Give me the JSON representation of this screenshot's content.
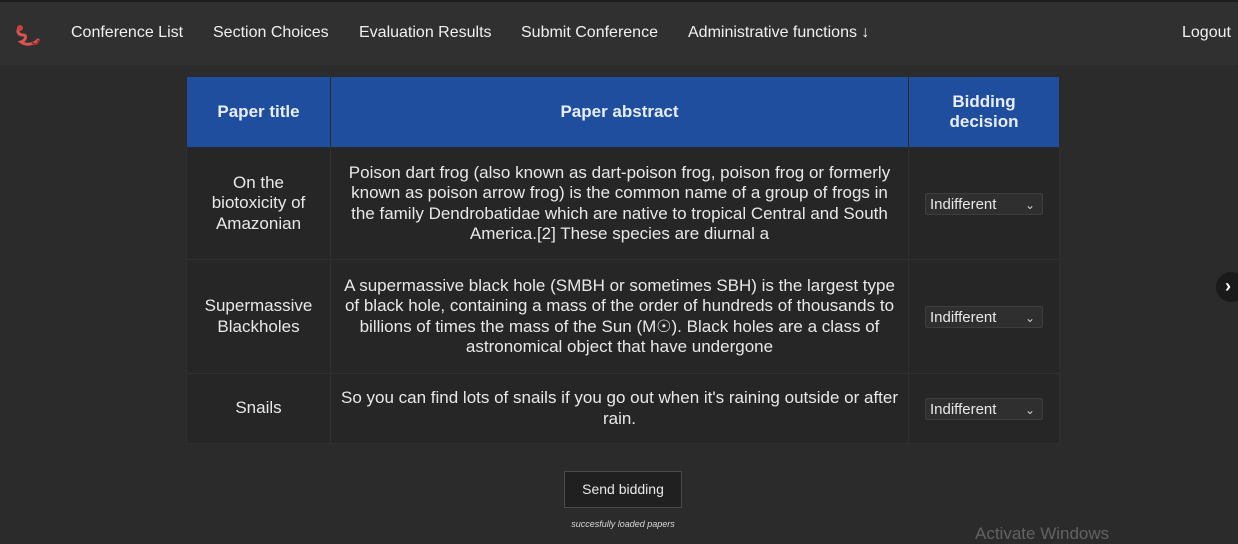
{
  "nav": {
    "logo_icon": "worm-logo-icon",
    "items": [
      {
        "label": "Conference List"
      },
      {
        "label": "Section Choices"
      },
      {
        "label": "Evaluation Results"
      },
      {
        "label": "Submit Conference"
      },
      {
        "label": "Administrative functions ↓"
      }
    ],
    "logout": "Logout"
  },
  "table": {
    "headers": [
      "Paper title",
      "Paper abstract",
      "Bidding decision"
    ],
    "rows": [
      {
        "title": "On the biotoxicity of Amazonian",
        "abstract": "Poison dart frog (also known as dart-poison frog, poison frog or formerly known as poison arrow frog) is the common name of a group of frogs in the family Dendrobatidae which are native to tropical Central and South America.[2] These species are diurnal a",
        "decision": "Indifferent"
      },
      {
        "title": "Supermassive Blackholes",
        "abstract": "A supermassive black hole (SMBH or sometimes SBH) is the largest type of black hole, containing a mass of the order of hundreds of thousands to billions of times the mass of the Sun (M☉). Black holes are a class of astronomical object that have undergone",
        "decision": "Indifferent"
      },
      {
        "title": "Snails",
        "abstract": "So you can find lots of snails if you go out when it's raining outside or after rain.",
        "decision": "Indifferent"
      }
    ]
  },
  "send_button": "Send bidding",
  "status_text": "succesfully loaded papers",
  "next_icon": "chevron-right-icon",
  "watermark": "Activate Windows",
  "colors": {
    "background": "#2b2b2b",
    "header_bar": "#303030",
    "table_header": "#1f4e9e",
    "row_background": "#262626"
  }
}
